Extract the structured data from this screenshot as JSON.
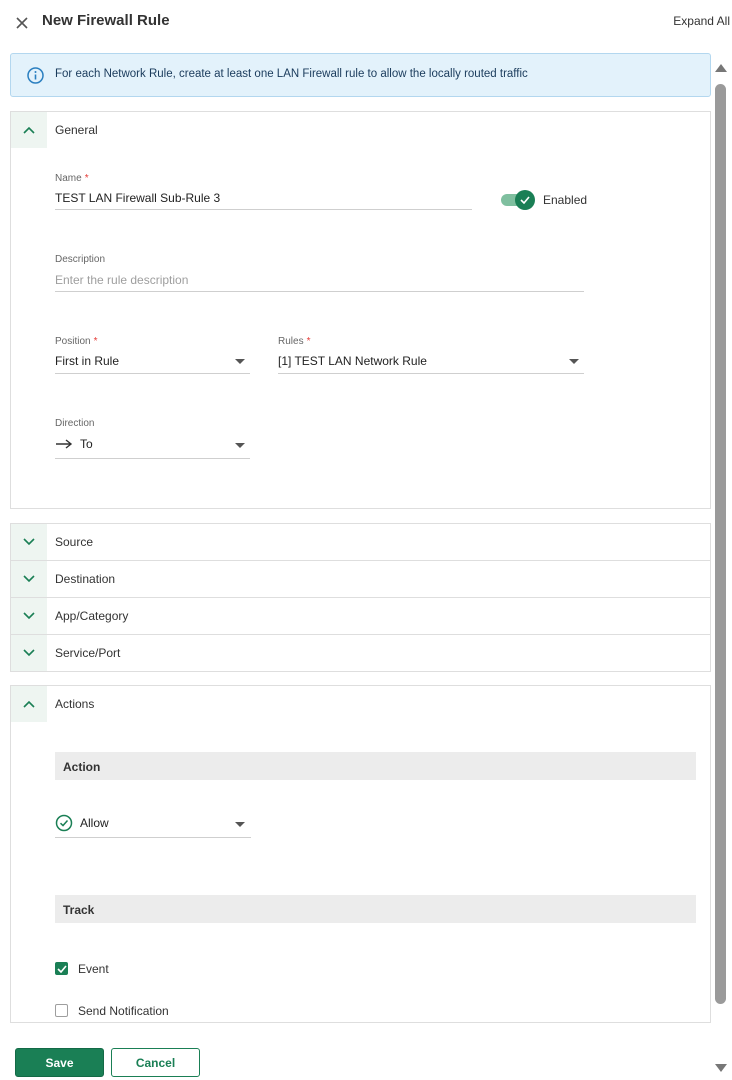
{
  "header": {
    "title": "New Firewall Rule",
    "expand_all": "Expand All",
    "close_icon": "close-icon"
  },
  "info_banner": {
    "icon": "info-icon",
    "text": "For each Network Rule, create at least one LAN Firewall rule to allow the locally routed traffic"
  },
  "general": {
    "title": "General",
    "name": {
      "label": "Name",
      "required": "*",
      "value": "TEST LAN Firewall Sub-Rule 3"
    },
    "enabled": {
      "label": "Enabled",
      "on": true
    },
    "description": {
      "label": "Description",
      "placeholder": "Enter the rule description"
    },
    "position": {
      "label": "Position",
      "required": "*",
      "value": "First in Rule"
    },
    "rules": {
      "label": "Rules",
      "required": "*",
      "value": "[1] TEST LAN Network Rule"
    },
    "direction": {
      "label": "Direction",
      "value": "To",
      "icon": "arrow-right-icon"
    }
  },
  "collapsed_sections": [
    {
      "title": "Source"
    },
    {
      "title": "Destination"
    },
    {
      "title": "App/Category"
    },
    {
      "title": "Service/Port"
    }
  ],
  "actions": {
    "title": "Actions",
    "action_band": "Action",
    "action_value": "Allow",
    "action_icon": "check-circle-icon",
    "track_band": "Track",
    "event": {
      "label": "Event",
      "checked": true
    },
    "send_notification": {
      "label": "Send Notification",
      "checked": false
    }
  },
  "footer": {
    "save": "Save",
    "cancel": "Cancel"
  },
  "colors": {
    "primary": "#1a7f55",
    "info_bg": "#e3f2fb",
    "required": "#e53935"
  }
}
